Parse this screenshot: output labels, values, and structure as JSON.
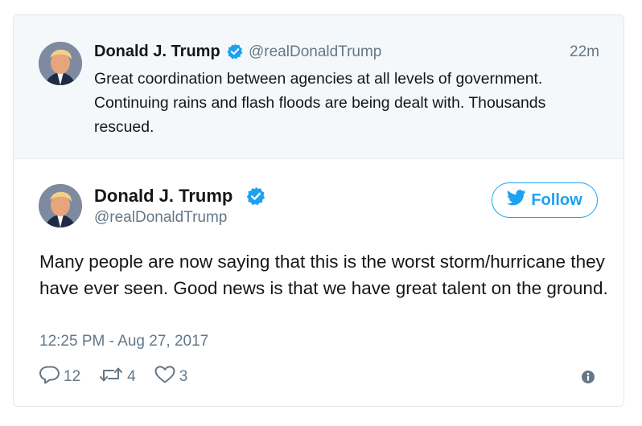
{
  "parent_tweet": {
    "author_name": "Donald J. Trump",
    "handle": "@realDonaldTrump",
    "time": "22m",
    "text": "Great coordination between agencies at all levels of government. Continuing rains and flash floods are being dealt with. Thousands rescued."
  },
  "main_tweet": {
    "author_name": "Donald J. Trump",
    "handle": "@realDonaldTrump",
    "follow_label": "Follow",
    "text": "Many people are now saying that this is the worst storm/hurricane they have ever seen. Good news is that we have great talent on the ground.",
    "date": "12:25 PM - Aug 27, 2017",
    "reply_count": "12",
    "retweet_count": "4",
    "like_count": "3"
  },
  "icons": {
    "verified": "verified-badge-icon",
    "bird": "twitter-bird-icon",
    "reply": "reply-icon",
    "retweet": "retweet-icon",
    "like": "heart-icon",
    "info": "info-icon"
  },
  "colors": {
    "accent": "#1da1f2",
    "secondary_text": "#657786",
    "parent_background": "#f5f8fa"
  }
}
